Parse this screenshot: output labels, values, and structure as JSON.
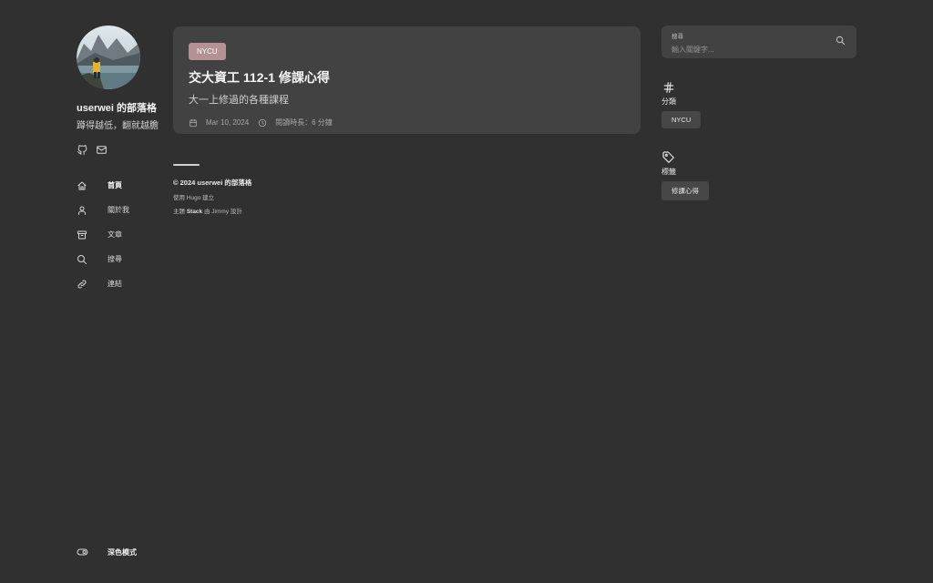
{
  "site": {
    "name": "userwei 的部落格",
    "description": "蹲得越低，翻就越膽"
  },
  "social": [
    {
      "icon": "github-icon"
    },
    {
      "icon": "email-icon"
    }
  ],
  "menu": [
    {
      "label": "首頁",
      "icon": "home-icon",
      "active": true
    },
    {
      "label": "關於我",
      "icon": "user-icon",
      "active": false
    },
    {
      "label": "文章",
      "icon": "archive-icon",
      "active": false
    },
    {
      "label": "搜尋",
      "icon": "search-icon",
      "active": false
    },
    {
      "label": "連結",
      "icon": "link-icon",
      "active": false
    }
  ],
  "dark_mode": {
    "label": "深色模式",
    "icon": "toggle-icon"
  },
  "article": {
    "category": "NYCU",
    "title": "交大資工 112-1 修課心得",
    "subtitle": "大一上修過的各種課程",
    "date": "Mar 10, 2024",
    "reading_time": "閱讀時長：6 分鐘"
  },
  "footer": {
    "copyright": "© 2024 userwei 的部落格",
    "built_prefix": "使用 Hugo 建立",
    "theme_prefix": "主題",
    "theme_name": "Stack",
    "theme_suffix": "由 Jimmy 設計"
  },
  "search": {
    "label": "搜尋",
    "placeholder": "輸入關鍵字..."
  },
  "categories": {
    "title": "分類",
    "items": [
      "NYCU"
    ]
  },
  "tags": {
    "title": "標籤",
    "items": [
      "修課心得"
    ]
  },
  "colors": {
    "background": "#303030",
    "card": "#424242",
    "category_tag": "#b59193"
  }
}
